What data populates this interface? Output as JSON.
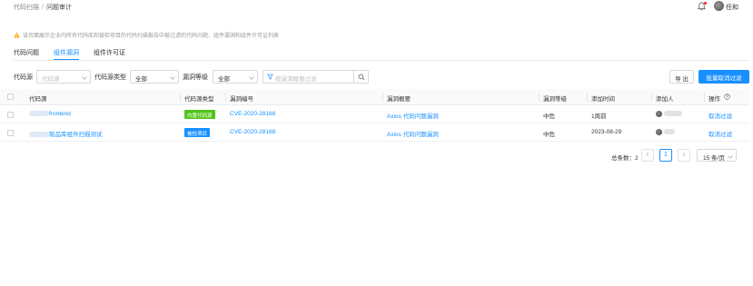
{
  "breadcrumb": {
    "parent": "代码扫描",
    "separator": "/",
    "current": "问题审计"
  },
  "user": {
    "name": "任和"
  },
  "notice": "该页面展示企业内所有代码库和被检项目的代码扫描报告中被过滤的代码问题、组件漏洞和组件许可证列表",
  "tabs": [
    {
      "label": "代码问题",
      "active": false
    },
    {
      "label": "组件漏洞",
      "active": true
    },
    {
      "label": "组件许可证",
      "active": false
    }
  ],
  "filters": {
    "source_label": "代码源",
    "source_placeholder": "代码源",
    "source_type_label": "代码源类型",
    "source_type_value": "全部",
    "level_label": "漏洞等级",
    "level_value": "全部",
    "search_placeholder": "按漏洞概要过滤"
  },
  "actions": {
    "export": "导 出",
    "batch_cancel": "批量取消过滤"
  },
  "table": {
    "columns": [
      "代码源",
      "代码源类型",
      "漏洞编号",
      "漏洞概要",
      "漏洞等级",
      "添加时间",
      "添加人",
      "操作"
    ],
    "rows": [
      {
        "source": "frontend",
        "source_type": "内置代码源",
        "source_type_color": "#52c41a",
        "cve": "CVE-2020-28168",
        "summary": "Axios 代码问题漏洞",
        "level": "中危",
        "added_time": "1周前",
        "action": "取消过滤"
      },
      {
        "source": "制品库组件扫描测试",
        "source_type": "被检项目",
        "source_type_color": "#1890ff",
        "cve": "CVE-2020-28168",
        "summary": "Axios 代码问题漏洞",
        "level": "中危",
        "added_time": "2023-08-29",
        "action": "取消过滤"
      }
    ]
  },
  "pagination": {
    "total_label": "总条数：2",
    "current_page": "1",
    "page_size": "15 条/页"
  },
  "colors": {
    "accent": "#1890ff",
    "success": "#52c41a",
    "warning": "#faad14",
    "badge": "#f5222d"
  }
}
